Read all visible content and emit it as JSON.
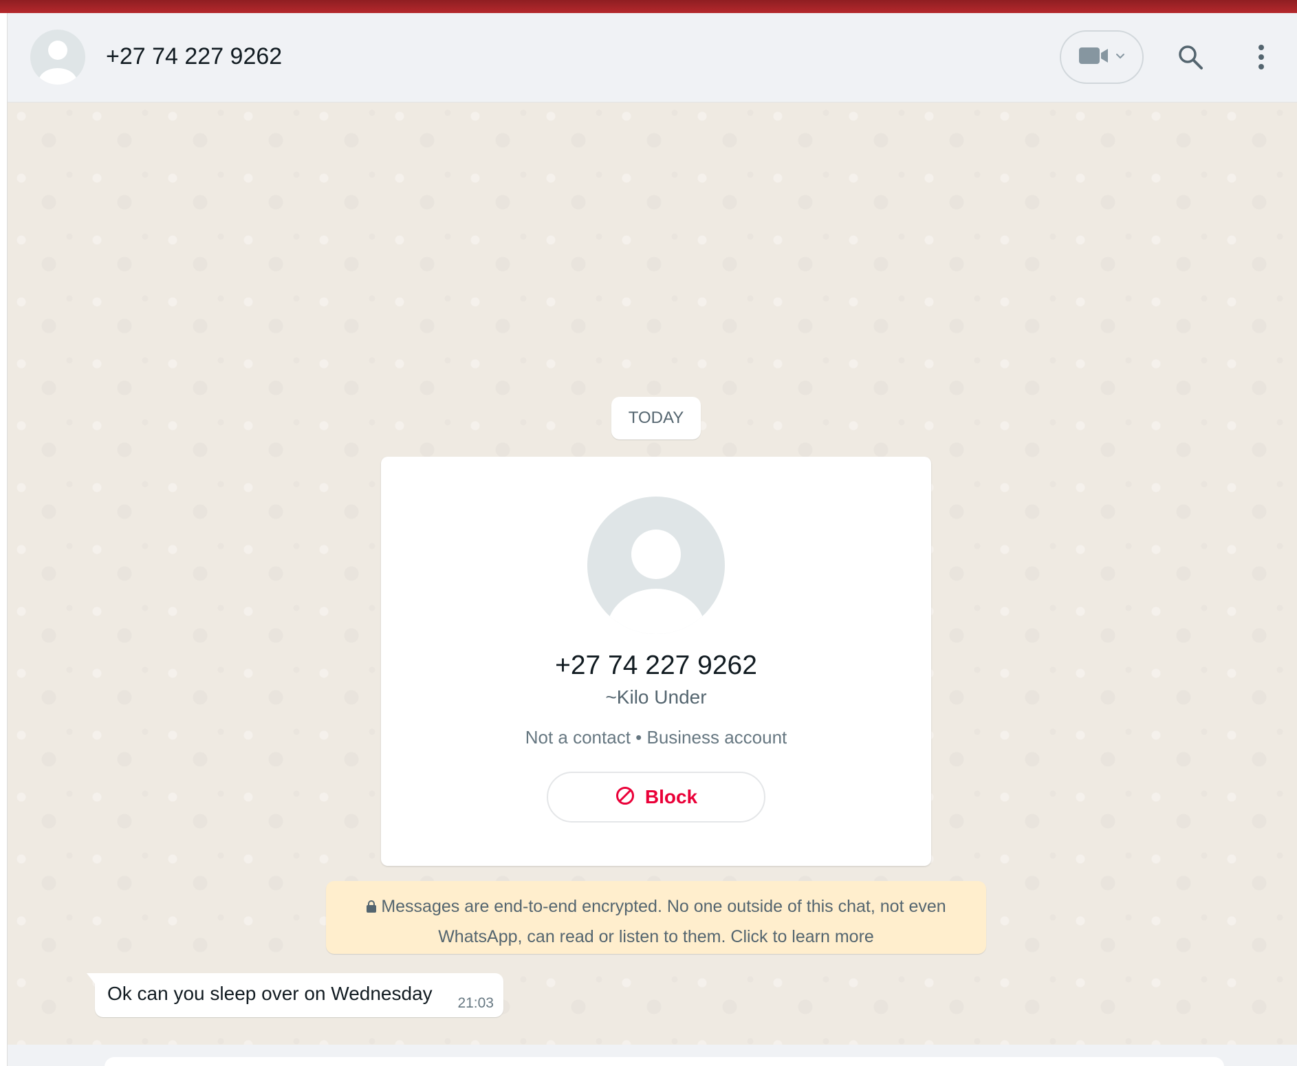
{
  "header": {
    "contact_title": "+27 74 227 9262",
    "icons": {
      "avatar": "default-avatar-icon",
      "video": "video-camera-icon",
      "dropdown": "chevron-down-icon",
      "search": "search-icon",
      "menu": "vertical-dots-icon"
    }
  },
  "chat": {
    "date_chip": "TODAY",
    "profile_card": {
      "phone": "+27 74 227 9262",
      "name": "~Kilo Under",
      "status": "Not a contact • Business account",
      "block_label": "Block",
      "block_icon": "block-icon"
    },
    "encryption_notice": {
      "text": "Messages are end-to-end encrypted. No one outside of this chat, not even WhatsApp, can read or listen to them. Click to learn more",
      "icon": "lock-icon"
    },
    "messages": [
      {
        "text": "Ok can you sleep over on Wednesday",
        "time": "21:03"
      }
    ]
  },
  "colors": {
    "top_strip": "#b5282c",
    "header_bg": "#f0f2f5",
    "chat_bg": "#efeae2",
    "block_red": "#ea0038",
    "notice_bg": "#ffeecd"
  }
}
